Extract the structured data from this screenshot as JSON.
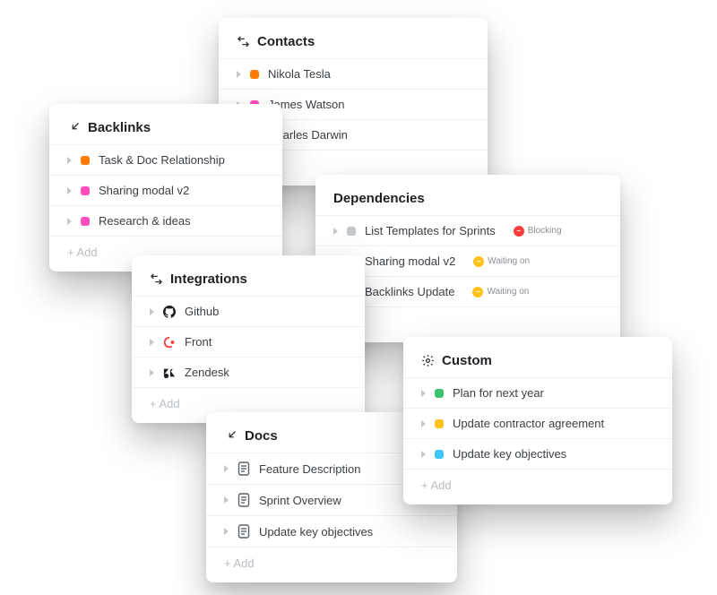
{
  "addLabel": "+ Add",
  "colors": {
    "orange": "#ff7a00",
    "pink": "#ff4dbd",
    "purple": "#8a6dff",
    "grey": "#c2c7cc",
    "green": "#3bc46b",
    "yellow": "#ffc21a",
    "blue": "#3fc6ff",
    "blocking": "#ff3b3b",
    "waiting": "#ffc21a"
  },
  "cards": {
    "contacts": {
      "title": "Contacts",
      "items": [
        {
          "label": "Nikola Tesla",
          "colorKey": "orange"
        },
        {
          "label": "James Watson",
          "colorKey": "pink"
        },
        {
          "label": "Charles Darwin",
          "colorKey": "purple"
        }
      ]
    },
    "backlinks": {
      "title": "Backlinks",
      "items": [
        {
          "label": "Task & Doc Relationship",
          "colorKey": "orange"
        },
        {
          "label": "Sharing modal v2",
          "colorKey": "pink"
        },
        {
          "label": "Research & ideas",
          "colorKey": "pink"
        }
      ]
    },
    "integrations": {
      "title": "Integrations",
      "items": [
        {
          "label": "Github",
          "brand": "github"
        },
        {
          "label": "Front",
          "brand": "front"
        },
        {
          "label": "Zendesk",
          "brand": "zendesk"
        }
      ]
    },
    "dependencies": {
      "title": "Dependencies",
      "items": [
        {
          "label": "List Templates for Sprints",
          "colorKey": "grey",
          "badge": {
            "text": "Blocking",
            "dotColorKey": "blocking",
            "glyph": "−"
          }
        },
        {
          "label": "Sharing modal v2",
          "colorKey": "pink",
          "badge": {
            "text": "Waiting on",
            "dotColorKey": "waiting",
            "glyph": "−"
          }
        },
        {
          "label": "Backlinks Update",
          "colorKey": "purple",
          "badge": {
            "text": "Waiting on",
            "dotColorKey": "waiting",
            "glyph": "−"
          }
        }
      ]
    },
    "docs": {
      "title": "Docs",
      "items": [
        {
          "label": "Feature Description"
        },
        {
          "label": "Sprint Overview"
        },
        {
          "label": "Update key objectives"
        }
      ]
    },
    "custom": {
      "title": "Custom",
      "items": [
        {
          "label": "Plan for next year",
          "colorKey": "green"
        },
        {
          "label": "Update contractor agreement",
          "colorKey": "yellow"
        },
        {
          "label": "Update key objectives",
          "colorKey": "blue"
        }
      ]
    }
  }
}
